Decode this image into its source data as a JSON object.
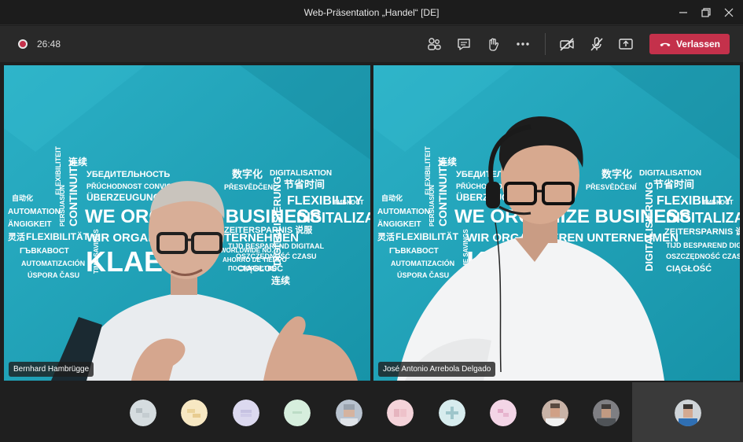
{
  "window": {
    "title": "Web-Präsentation „Handel“ [DE]"
  },
  "meeting": {
    "timer": "26:48",
    "leave_label": "Verlassen",
    "icons": [
      "participants-icon",
      "chat-icon",
      "raise-hand-icon",
      "more-icon",
      "camera-off-icon",
      "mic-off-icon",
      "share-icon",
      "phone-icon"
    ]
  },
  "participants": {
    "left_name": "Bernhard Hambrügge",
    "right_name": "José Antonio Arrebola Delgado"
  },
  "background_words": {
    "line1": "连续",
    "line2": "УБЕДИТЕЛЬНОСТЬ",
    "line3": "PŘÚCHODNOST CONVICCIÓN",
    "line4": "ÜBERZEUGUNG",
    "line5": "WE ORGANIZE BUSINESS",
    "line6": "WIR ORGANISIEREN UNTERNEHMEN",
    "line7": "KLAES",
    "line8": "AUTOMATION",
    "line9": "FLEXIBILITÄT",
    "line10": "DIGITALISATION",
    "line11": "FLEXIBILITY",
    "line12": "DIGITALIZATION",
    "line13": "ZEITERSPARNIS 说服",
    "line14": "TIJD BESPAREND DIGITAAL",
    "line15": "OSZCZĘDNOŚĆ CZASU",
    "line16": "CIĄGŁOŚĆ",
    "line17": "ГЪВКАВОСТ",
    "line18": "AUTOMATIZACIÓN",
    "line19": "ÚSPORA ČASU",
    "line20": "数字化",
    "line21": "节省时间",
    "line22": "PŘESVĚDČENÍ",
    "line23": "CONTINUITY",
    "line24": "ПОСТОЯНСТВО",
    "line25": "AHORRO DE TIEMPO",
    "line26": "DIGITALISIERUNG",
    "line27": "PERSUASION",
    "line28": "TIME SAVINGS",
    "line29": "FLEXIBILITEIT",
    "line30": "WORLDWIDE NO. 1",
    "line31": "ГИБКОСТ",
    "line32": "自动化",
    "line33": "ÄNGIGKEIT",
    "line34": "灵活"
  },
  "colors": {
    "leave": "#c4314b",
    "video_bg": "#22a5bb"
  }
}
